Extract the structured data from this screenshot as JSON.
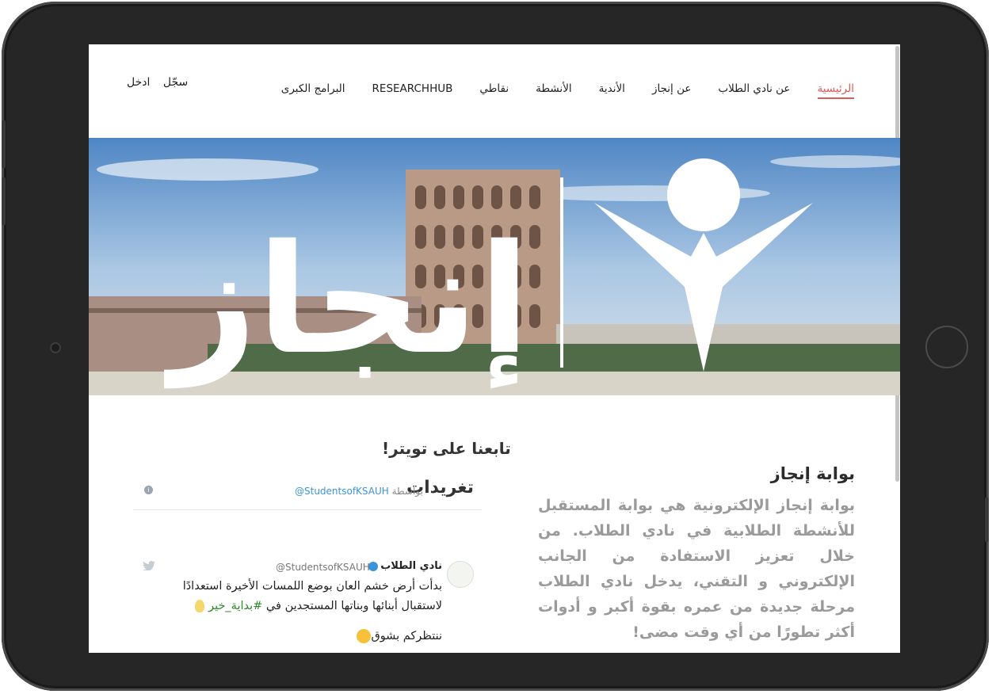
{
  "nav": {
    "auth": {
      "login": "ادخل",
      "register": "سجّل"
    },
    "items": [
      {
        "label": "الرئيسية",
        "active": true
      },
      {
        "label": "عن نادي الطلاب",
        "active": false
      },
      {
        "label": "عن إنجاز",
        "active": false
      },
      {
        "label": "الأندية",
        "active": false
      },
      {
        "label": "الأنشطة",
        "active": false
      },
      {
        "label": "نقاطي",
        "active": false
      },
      {
        "label": "RESEARCHHUB",
        "active": false
      },
      {
        "label": "البرامج الكبرى",
        "active": false
      }
    ],
    "active_color": "#e05a5a"
  },
  "hero": {
    "logo_text": "إنجاز"
  },
  "portal": {
    "title": "بوابة إنجاز",
    "body": "بوابة إنجاز الإلكترونية هي بوابة المستقبل للأنشطة الطلابية في نادي الطلاب. من خلال تعزيز الاستفادة من الجانب الإلكتروني و التقني، يدخل نادي الطلاب مرحلة جديدة من عمره بقوة أكبر و أدوات أكثر تطورًا من أي وقت مضى!"
  },
  "twitter": {
    "follow_title": "تابعنا على تويتر!",
    "widget_title": "تغريدات",
    "by_label": "بواسطة",
    "by_handle": "@StudentsofKSAUH",
    "tweet": {
      "author": "نادي الطلاب",
      "handle": "@StudentsofKSAUH",
      "text_main": "بدأت أرض خشم العان بوضع اللمسات الأخيرة استعدادًا لاستقبال أبنائها وبناتها المستجدين في ",
      "hashtag": "#بداية_خير",
      "text_second": "ننتظركم بشوق"
    }
  }
}
